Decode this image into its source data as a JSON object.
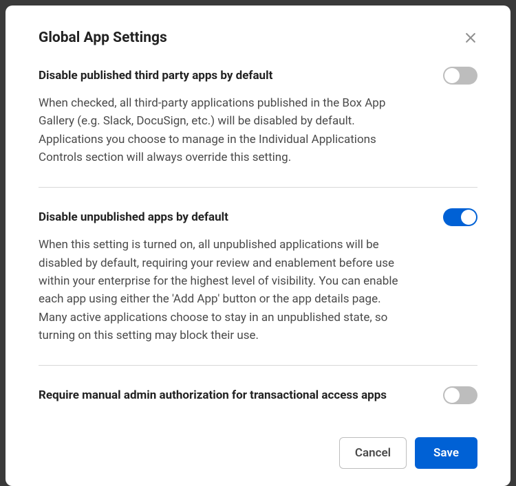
{
  "modal": {
    "title": "Global App Settings"
  },
  "settings": {
    "disablePublished": {
      "title": "Disable published third party apps by default",
      "description": "When checked, all third-party applications published in the Box App Gallery (e.g. Slack, DocuSign, etc.) will be disabled by default. Applications you choose to manage in the Individual Applications Controls section will always override this setting.",
      "enabled": false
    },
    "disableUnpublished": {
      "title": "Disable unpublished apps by default",
      "description": "When this setting is turned on, all unpublished applications will be disabled by default, requiring your review and enablement before use within your enterprise for the highest level of visibility. You can enable each app using either the 'Add App' button or the app details page. Many active applications choose to stay in an unpublished state, so turning on this setting may block their use.",
      "enabled": true
    },
    "requireManualAuth": {
      "title": "Require manual admin authorization for transactional access apps",
      "enabled": false
    }
  },
  "buttons": {
    "cancel": "Cancel",
    "save": "Save"
  }
}
